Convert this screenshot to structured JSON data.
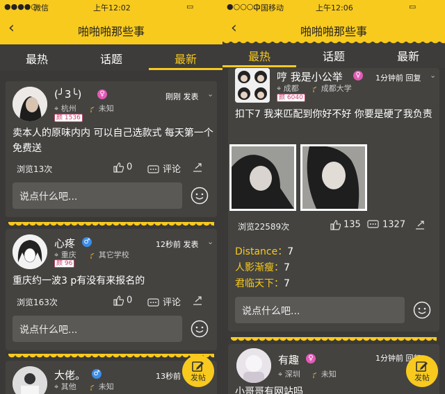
{
  "left": {
    "status": {
      "carrier": "微信",
      "signal": "●●●●○",
      "time": "上午12:02"
    },
    "nav": {
      "title": "啪啪啪那些事"
    },
    "tabs": [
      {
        "label": "最热"
      },
      {
        "label": "话题"
      },
      {
        "label": "最新"
      }
    ],
    "posts": [
      {
        "name": "(╯3╰)",
        "location": "杭州",
        "school": "未知",
        "badge": "1536",
        "time": "刚刚 发表",
        "content": "卖本人的原味内内 可以自己选款式 每天第一个免费送",
        "views": "浏览13次",
        "likes": "0",
        "comment_label": "评论",
        "input_placeholder": "说点什么吧..."
      },
      {
        "name": "心疼",
        "location": "重庆",
        "school": "其它学校",
        "badge": "96",
        "time": "12秒前 发表",
        "content": "重庆约一波3 p有没有来报名的",
        "views": "浏览163次",
        "likes": "0",
        "comment_label": "评论",
        "input_placeholder": "说点什么吧..."
      },
      {
        "name": "大佬。",
        "location": "其他",
        "school": "未知",
        "time": "13秒前"
      }
    ],
    "fab": {
      "label": "发帖"
    }
  },
  "right": {
    "status": {
      "carrier": "中国移动",
      "signal": "●○○○○",
      "time": "上午12:06"
    },
    "nav": {
      "title": "啪啪啪那些事"
    },
    "tabs": [
      {
        "label": "最热"
      },
      {
        "label": "话题"
      },
      {
        "label": "最新"
      }
    ],
    "post": {
      "name": "哼 我是小公举",
      "location": "成都",
      "school": "成都大学",
      "badge": "6040",
      "time": "1分钟前 回复",
      "content": "扣下7 我来匹配到你好不好 你要是硬了我负责",
      "views": "浏览22589次",
      "likes": "135",
      "comments": "1327",
      "replies": [
        {
          "key": "Distance",
          "value": "7"
        },
        {
          "key": "人影渐瘦",
          "value": "7"
        },
        {
          "key": "君临天下",
          "value": "7"
        }
      ],
      "input_placeholder": "说点什么吧..."
    },
    "post2": {
      "name": "有趣",
      "location": "深圳",
      "school": "未知",
      "time": "1分钟前 回复",
      "content": "小哥哥有网站吗"
    },
    "fab": {
      "label": "发帖"
    }
  },
  "colors": {
    "accent": "#f8ca1e",
    "background": "#3a3937",
    "card": "#444340",
    "female": "#e25bb5",
    "male": "#3b8ce8"
  }
}
